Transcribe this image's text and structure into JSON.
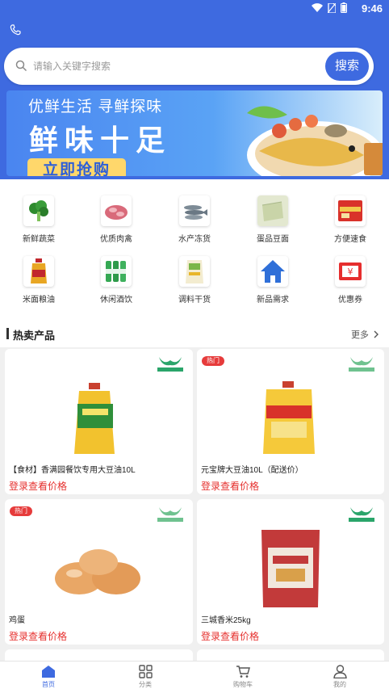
{
  "status_bar": {
    "time": "9:46"
  },
  "search": {
    "placeholder": "请输入关键字搜索",
    "button_label": "搜索"
  },
  "banner": {
    "line1": "优鲜生活  寻鲜探味",
    "line2": "鲜味十足",
    "cta": "立即抢购"
  },
  "categories": [
    {
      "label": "新鲜蔬菜",
      "icon": "broccoli-icon"
    },
    {
      "label": "优质肉禽",
      "icon": "meat-icon"
    },
    {
      "label": "水产冻货",
      "icon": "fish-icon"
    },
    {
      "label": "蛋品豆面",
      "icon": "tofu-icon"
    },
    {
      "label": "方便速食",
      "icon": "instant-noodle-icon"
    },
    {
      "label": "米面粮油",
      "icon": "oil-bottle-icon"
    },
    {
      "label": "休闲酒饮",
      "icon": "drinks-icon"
    },
    {
      "label": "调料干货",
      "icon": "seasoning-icon"
    },
    {
      "label": "新品需求",
      "icon": "home-icon"
    },
    {
      "label": "优惠券",
      "icon": "coupon-icon"
    }
  ],
  "hot_section": {
    "title": "热卖产品",
    "more": "更多"
  },
  "products": [
    {
      "name": "【食材】香满园餐饮专用大豆油10L",
      "price": "登录查看价格",
      "hot": false
    },
    {
      "name": "元宝牌大豆油10L（配送价）",
      "price": "登录查看价格",
      "hot": true,
      "hot_label": "热门"
    },
    {
      "name": "鸡蛋",
      "price": "登录查看价格",
      "hot": true,
      "hot_label": "热门"
    },
    {
      "name": "三城香米25kg",
      "price": "登录查看价格",
      "hot": false
    }
  ],
  "tabs": [
    {
      "label": "首页",
      "icon": "home-tab-icon",
      "active": true
    },
    {
      "label": "分类",
      "icon": "grid-icon",
      "active": false
    },
    {
      "label": "购物车",
      "icon": "cart-icon",
      "active": false
    },
    {
      "label": "我的",
      "icon": "user-icon",
      "active": false
    }
  ],
  "colors": {
    "primary": "#3e6ae0",
    "price": "#e6302e",
    "hot_badge": "#e63b3b",
    "logo_green": "#2aa56a"
  }
}
